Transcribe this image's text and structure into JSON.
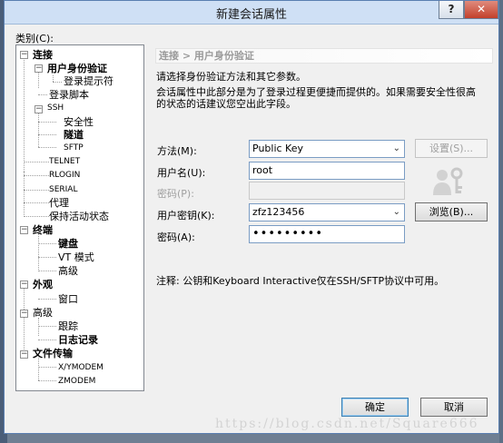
{
  "window": {
    "title": "新建会话属性",
    "help_label": "?",
    "close_label": "✕"
  },
  "category_label": "类别(C):",
  "tree": [
    {
      "label": "连接",
      "bold": true,
      "expander": "−"
    },
    {
      "label": "用户身份验证",
      "bold": true,
      "expander": "−"
    },
    {
      "label": "登录提示符",
      "bold": false
    },
    {
      "label": "登录脚本",
      "bold": false
    },
    {
      "label": "SSH",
      "bold": false,
      "expander": "−"
    },
    {
      "label": "安全性",
      "bold": false
    },
    {
      "label": "隧道",
      "bold": true
    },
    {
      "label": "SFTP",
      "bold": false
    },
    {
      "label": "TELNET",
      "bold": false
    },
    {
      "label": "RLOGIN",
      "bold": false
    },
    {
      "label": "SERIAL",
      "bold": false
    },
    {
      "label": "代理",
      "bold": false
    },
    {
      "label": "保持活动状态",
      "bold": false
    },
    {
      "label": "终端",
      "bold": true,
      "expander": "−"
    },
    {
      "label": "键盘",
      "bold": true
    },
    {
      "label": "VT 模式",
      "bold": false
    },
    {
      "label": "高级",
      "bold": false
    },
    {
      "label": "外观",
      "bold": true,
      "expander": "−"
    },
    {
      "label": "窗口",
      "bold": false
    },
    {
      "label": "高级",
      "bold": false,
      "expander": "−"
    },
    {
      "label": "跟踪",
      "bold": false
    },
    {
      "label": "日志记录",
      "bold": true
    },
    {
      "label": "文件传输",
      "bold": true,
      "expander": "−"
    },
    {
      "label": "X/YMODEM",
      "bold": false
    },
    {
      "label": "ZMODEM",
      "bold": false
    }
  ],
  "panel": {
    "breadcrumb": "连接 > 用户身份验证",
    "desc1": "请选择身份验证方法和其它参数。",
    "desc2": "会话属性中此部分是为了登录过程更便捷而提供的。如果需要安全性很高",
    "desc3": "的状态的话建议您空出此字段。"
  },
  "form": {
    "method_label": "方法(M):",
    "method_value": "Public Key",
    "settings_button": "设置(S)...",
    "username_label": "用户名(U):",
    "username_value": "root",
    "password_label": "密码(P):",
    "password_value": "",
    "userkey_label": "用户密钥(K):",
    "userkey_value": "zfz123456",
    "browse_button": "浏览(B)...",
    "passphrase_label": "密码(A):",
    "passphrase_value": "•••••••••"
  },
  "note": "注释: 公钥和Keyboard Interactive仅在SSH/SFTP协议中可用。",
  "buttons": {
    "ok": "确定",
    "cancel": "取消"
  },
  "watermark": "https://blog.csdn.net/Square666",
  "icons": {
    "dropdown": "chevron-down-icon",
    "user_key": "user-key-icon"
  },
  "colors": {
    "titlebar": "#cfe0f5",
    "close": "#c3402c",
    "field_border": "#7a9cc4",
    "default_button": "#3c7fb1"
  }
}
